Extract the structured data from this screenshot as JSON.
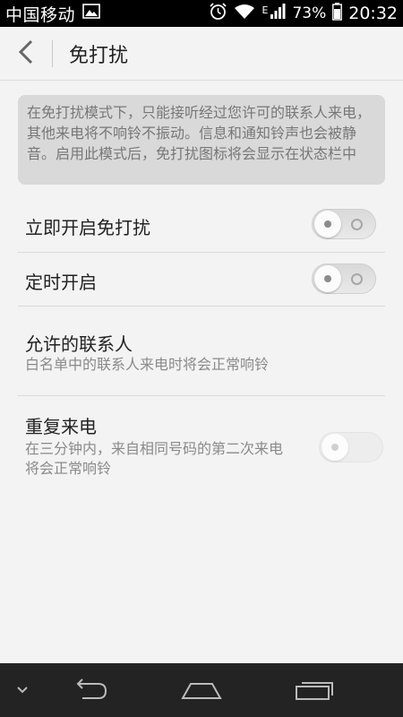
{
  "status_bar": {
    "carrier": "中国移动",
    "network": "E",
    "battery": "73%",
    "time": "20:32",
    "icons": [
      "image-icon",
      "alarm-icon",
      "wifi-icon",
      "signal-icon",
      "battery-icon"
    ]
  },
  "header": {
    "title": "免打扰",
    "back_icon": "back-arrow-icon"
  },
  "note": {
    "text": "在免打扰模式下，只能接听经过您许可的联系人来电，其他来电将不响铃不振动。信息和通知铃声也会被静音。启用此模式后，免打扰图标将会显示在状态栏中"
  },
  "settings": [
    {
      "title": "立即开启免打扰",
      "toggle": "off"
    },
    {
      "title": "定时开启",
      "toggle": "off"
    },
    {
      "title": "允许的联系人",
      "subtitle": "白名单中的联系人来电时将会正常响铃"
    },
    {
      "title": "重复来电",
      "subtitle_line1": "在三分钟内，来自相同号码的第二次来电",
      "subtitle_line2": "将会正常响铃",
      "toggle": "off-disabled"
    }
  ],
  "nav_bar": {
    "icons": [
      "chevron-down-icon",
      "back-icon",
      "home-icon",
      "recents-icon"
    ]
  },
  "colors": {
    "background": "#f3f3f3",
    "status_bar": "#000000",
    "nav_bar": "#232323",
    "note_bg": "#d9d9d9"
  }
}
